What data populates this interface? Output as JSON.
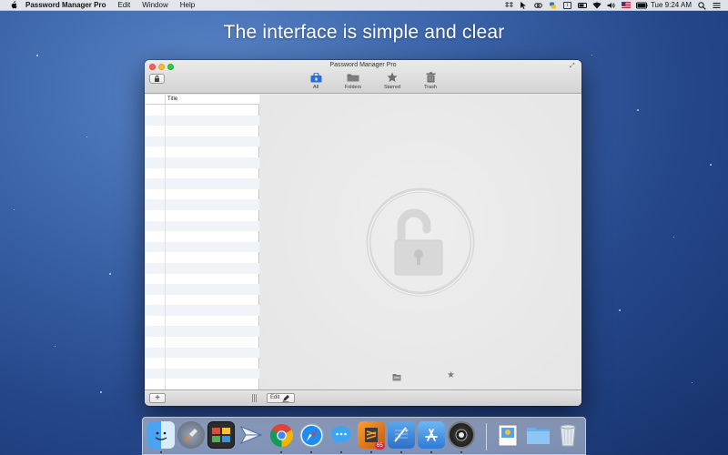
{
  "menubar": {
    "app_name": "Password Manager Pro",
    "menus": [
      "Edit",
      "Window",
      "Help"
    ],
    "clock": "Tue 9:24 AM",
    "status_icons": [
      "dropbox-icon",
      "cursor-icon",
      "link-icon",
      "python-icon",
      "info-icon",
      "battery-icon",
      "wifi-icon",
      "volume-icon",
      "flag-icon",
      "battery-status-icon",
      "search-icon",
      "notification-center-icon"
    ],
    "status_box_label": "i"
  },
  "caption": "The interface is simple and clear",
  "window": {
    "title": "Password Manager Pro",
    "toolbar": [
      {
        "label": "All",
        "icon": "lock-box-icon",
        "selected": true
      },
      {
        "label": "Folders",
        "icon": "folder-icon",
        "selected": false
      },
      {
        "label": "Starred",
        "icon": "star-icon",
        "selected": false
      },
      {
        "label": "Trash",
        "icon": "trash-icon",
        "selected": false
      }
    ],
    "list_header": "Title",
    "bottom": {
      "add_label": "+",
      "edit_label": "Edit"
    }
  },
  "dock": {
    "apps": [
      "Finder",
      "Launchpad",
      "Photo Booth",
      "Mail Sender",
      "Chrome",
      "Safari",
      "Messages",
      "Sublime",
      "Xcode",
      "App Store",
      "Camera",
      "Preview",
      "Folder",
      "Trash"
    ],
    "badge": "65"
  },
  "colors": {
    "accent": "#2a6fd6",
    "close": "#fc5f57",
    "minimize": "#fdbc2e",
    "maximize": "#34c84a"
  }
}
